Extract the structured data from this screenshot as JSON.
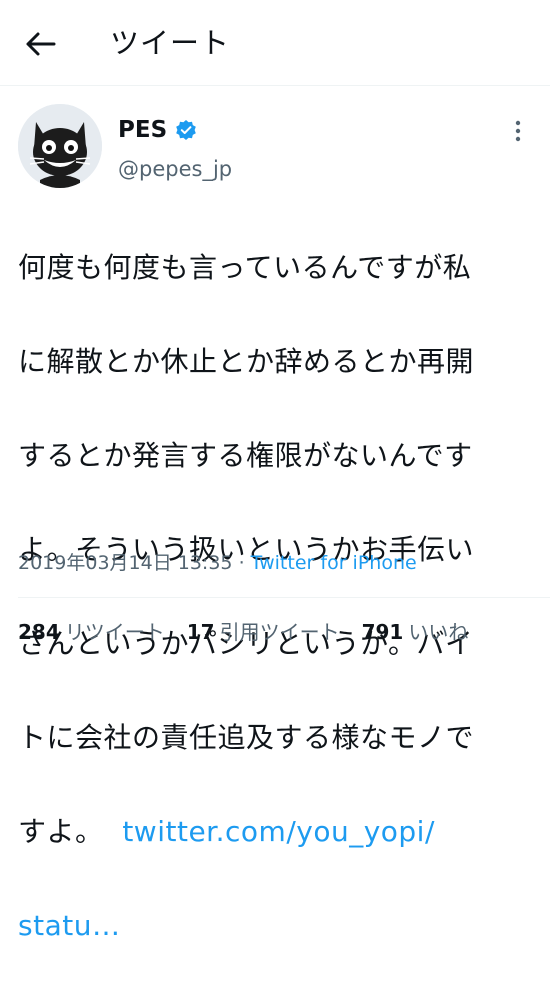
{
  "header": {
    "back_icon": "arrow-left-icon",
    "title": "ツイート"
  },
  "author": {
    "display_name": "PES",
    "verified_icon": "verified-badge-icon",
    "handle": "@pepes_jp",
    "avatar_icon": "black-cat-avatar",
    "more_icon": "vertical-ellipsis-icon"
  },
  "tweet": {
    "lines": [
      "何度も何度も言っているんですが私",
      "に解散とか休止とか辞めるとか再開",
      "するとか発言する権限がないんです",
      "よ。そういう扱いというかお手伝い",
      "さんというかパシリというか。バイ",
      "トに会社の責任追及する様なモノで"
    ],
    "last_line_text": "すよ。",
    "link_part1": "twitter.com/you_yopi/",
    "link_part2": "statu…"
  },
  "meta": {
    "timestamp": "2019年03月14日 13:35",
    "separator": "·",
    "source": "Twitter for iPhone"
  },
  "stats": {
    "retweets_count": "284",
    "retweets_label": "リツイート",
    "quotes_count": "17",
    "quotes_label": "引用ツイート",
    "likes_count": "791",
    "likes_label": "いいね"
  },
  "colors": {
    "accent": "#1d9bf0",
    "text": "#0f1419",
    "secondary": "#536471",
    "divider": "#eff3f4"
  }
}
